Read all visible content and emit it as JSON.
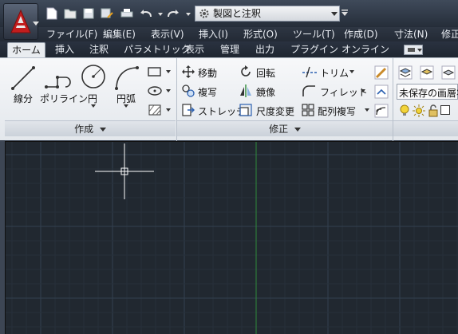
{
  "workspace": {
    "value": "製図と注釈"
  },
  "menu": [
    "ファイル(F)",
    "編集(E)",
    "表示(V)",
    "挿入(I)",
    "形式(O)",
    "ツール(T)",
    "作成(D)",
    "寸法(N)",
    "修正"
  ],
  "tabs": [
    "ホーム",
    "挿入",
    "注釈",
    "パラメトリック",
    "表示",
    "管理",
    "出力",
    "プラグイン",
    "オンライン"
  ],
  "create_panel": {
    "tools": {
      "line": "線分",
      "polyline": "ポリライン",
      "circle": "円",
      "arc": "円弧"
    },
    "title": "作成"
  },
  "modify_panel": {
    "tools": {
      "move": "移動",
      "rotate": "回転",
      "trim": "トリム",
      "copy": "複写",
      "mirror": "鏡像",
      "fillet": "フィレット",
      "stretch": "ストレッチ",
      "scale": "尺度変更",
      "array": "配列複写"
    },
    "title": "修正"
  },
  "layer_panel": {
    "state": "未保存の画層状"
  },
  "colors": {
    "ribbon_bg": "#eef0f3",
    "drawing_bg": "#212830",
    "grid_major": "#33404f",
    "axis_y": "#2f8a3a"
  }
}
